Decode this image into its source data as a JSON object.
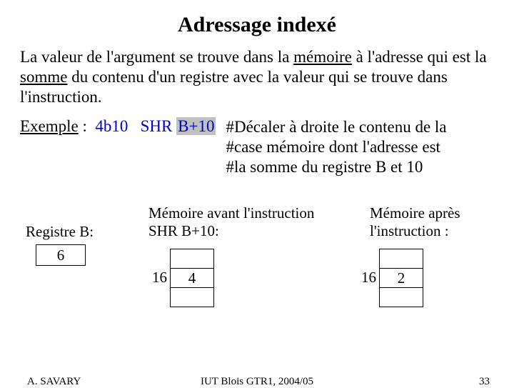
{
  "title": "Adressage indexé",
  "paragraph": {
    "p1a": "La valeur de l'argument se trouve dans la ",
    "p1_u1": "mémoire",
    "p1b": " à l'adresse qui est la ",
    "p1_u2": "somme",
    "p1c": " du contenu d'un registre avec la valeur qui se trouve dans l'instruction."
  },
  "example": {
    "label": "Exemple",
    "colon": " : ",
    "opcode": "4b10",
    "mnemonic": "SHR",
    "operand": "B+10",
    "comment1": "#Décaler à droite le contenu de la",
    "comment2": "#case mémoire dont l'adresse est",
    "comment3": "#la somme du registre B et 10"
  },
  "register": {
    "label": "Registre B:",
    "value": "6"
  },
  "memory": {
    "before_label": "Mémoire avant l'instruction SHR B+10:",
    "after_label": "Mémoire après l'instruction :",
    "addr": "16",
    "before_value": "4",
    "after_value": "2"
  },
  "footer": {
    "author": "A. SAVARY",
    "center": "IUT Blois GTR1, 2004/05",
    "page": "33"
  }
}
